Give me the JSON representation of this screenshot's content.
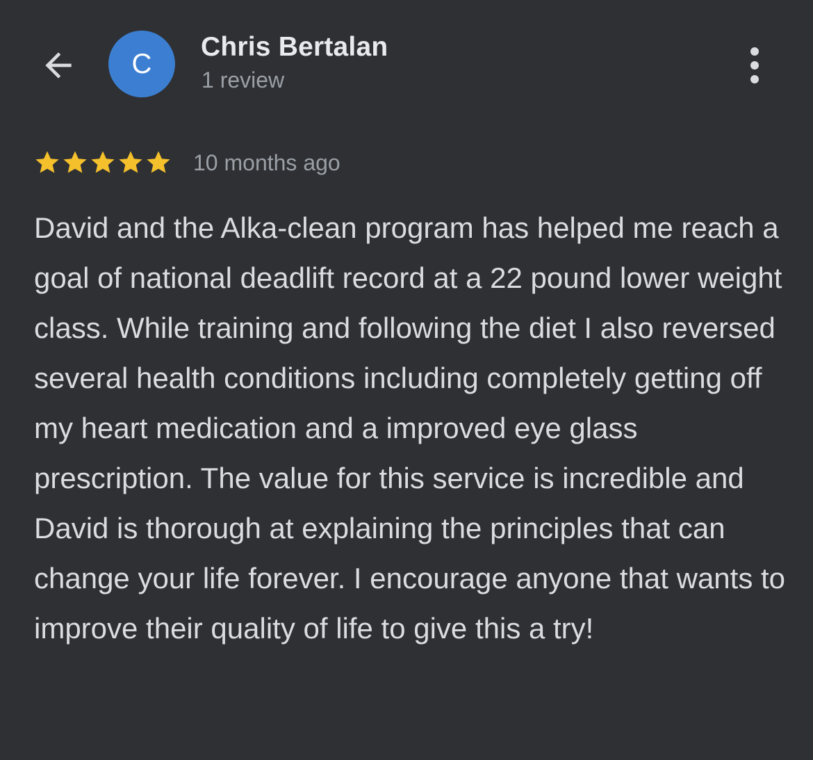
{
  "reviewer": {
    "name": "Chris Bertalan",
    "review_count": "1 review",
    "avatar_letter": "C",
    "avatar_color": "#3c7fd2"
  },
  "header": {
    "back_icon": "arrow-left-icon",
    "more_icon": "more-vertical-icon"
  },
  "review": {
    "rating": 5,
    "max_rating": 5,
    "star_color": "#f4c02c",
    "time": "10 months ago",
    "text": "David and the Alka-clean program has helped me reach a goal of national deadlift record at a 22 pound lower weight class. While training and following the diet I also reversed several health conditions including completely getting off my heart medication and a improved eye glass prescription. The value for this service is incredible and David is thorough at explaining the principles that can change your life forever. I encourage anyone that wants to improve their quality of life to give this a try!"
  },
  "colors": {
    "background": "#2f3033",
    "primary_text": "#e8eaed",
    "secondary_text": "#9aa0a6",
    "body_text": "#dadce0"
  }
}
